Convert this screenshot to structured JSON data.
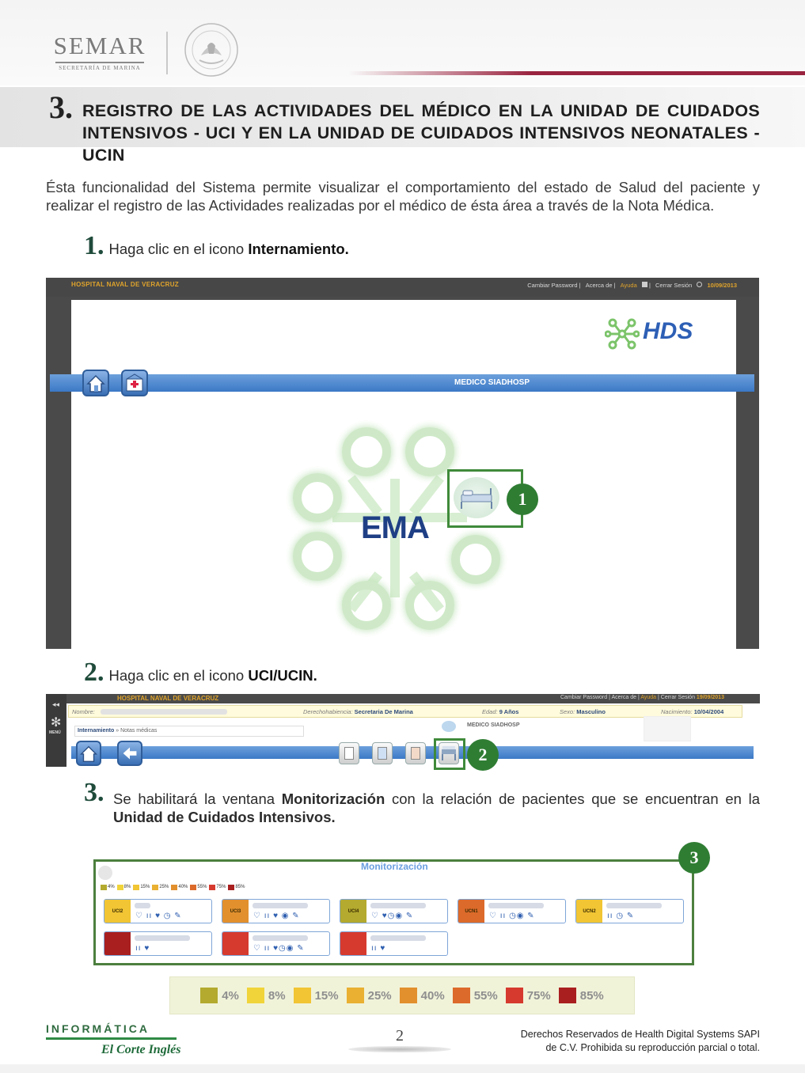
{
  "header": {
    "org_name": "SEMAR",
    "org_subtitle": "SECRETARÍA DE MARINA",
    "seal_text": "ESTADOS UNIDOS MEXICANOS"
  },
  "section": {
    "number": "3.",
    "title_line1": "REGISTRO DE LAS ACTIVIDADES DEL MÉDICO EN LA UNIDAD DE CUIDADOS",
    "title_line2": "INTENSIVOS - UCI Y EN LA UNIDAD DE CUIDADOS INTENSIVOS NEONATALES - UCIN"
  },
  "intro": "Ésta funcionalidad del Sistema permite visualizar el comportamiento del estado de Salud del paciente y realizar el registro de las Actividades realizadas por el médico de ésta área a través de la Nota Médica.",
  "steps": [
    {
      "num": "1.",
      "text": "Haga clic en el icono ",
      "bold": "Internamiento."
    },
    {
      "num": "2.",
      "text": "Haga clic en el icono ",
      "bold": "UCI/UCIN."
    },
    {
      "num": "3.",
      "text_a": "Se habilitará la ventana ",
      "bold_a": "Monitorización",
      "text_b": " con la relación de pacientes que se encuentran en la ",
      "bold_b": "Unidad de Cuidados Intensivos."
    }
  ],
  "screenshot1": {
    "hospital": "HOSPITAL NAVAL DE VERACRUZ",
    "links": [
      "Cambiar Password",
      "Acerca de",
      "Ayuda",
      "Cerrar Sesión"
    ],
    "date": "10/09/2013",
    "brand": "HDS",
    "banner": "MEDICO SIADHOSP",
    "center_logo": "EMA",
    "callout": "1",
    "icons": [
      "home-icon",
      "hospital-icon",
      "bed-icon"
    ]
  },
  "screenshot2": {
    "hospital": "HOSPITAL NAVAL DE VERACRUZ",
    "links": [
      "Cambiar Password",
      "Acerca de",
      "Ayuda",
      "Cerrar Sesión"
    ],
    "date": "19/09/2013",
    "patient": {
      "nombre_label": "Nombre:",
      "derecho_label": "Derechohabiencia:",
      "derecho_value": "Secretaria De Marina",
      "edad_label": "Edad:",
      "edad_value": "9 Años",
      "sexo_label": "Sexo:",
      "sexo_value": "Masculino",
      "nac_label": "Nacimiento:",
      "nac_value": "10/04/2004"
    },
    "breadcrumb_main": "Internamiento",
    "breadcrumb_sub": " » Notas médicas",
    "menu_label": "MENÚ",
    "banner": "MEDICO SIADHOSP",
    "callout": "2"
  },
  "monitor": {
    "title": "Monitorización",
    "callout": "3",
    "legend": [
      {
        "label": "4%",
        "color": "#b3aa2f"
      },
      {
        "label": "8%",
        "color": "#f0d43a"
      },
      {
        "label": "15%",
        "color": "#f1c534"
      },
      {
        "label": "25%",
        "color": "#e9b032"
      },
      {
        "label": "40%",
        "color": "#e2902e"
      },
      {
        "label": "55%",
        "color": "#dc6a2a"
      },
      {
        "label": "75%",
        "color": "#d63a2e"
      },
      {
        "label": "85%",
        "color": "#a91f1f"
      }
    ],
    "cards": [
      {
        "label": "UCI2",
        "color": "#f1c534",
        "icons": "♡ ıı ♥ ◷ ✎"
      },
      {
        "label": "UCI3",
        "color": "#e2902e",
        "icons": "♡ ıı ♥  ◉ ✎"
      },
      {
        "label": "UCI4",
        "color": "#b3aa2f",
        "icons": "♡  ♥◷◉ ✎"
      },
      {
        "label": "UCN1",
        "color": "#dc6a2a",
        "icons": "♡ ıı  ◷◉ ✎"
      },
      {
        "label": "UCN2",
        "color": "#f1c534",
        "icons": "  ıı  ◷  ✎"
      },
      {
        "label": "",
        "color": "#a91f1f",
        "icons": "  ıı ♥"
      },
      {
        "label": "",
        "color": "#d63a2e",
        "icons": "♡ ıı ♥◷◉ ✎"
      },
      {
        "label": "",
        "color": "#d63a2e",
        "icons": "  ıı ♥"
      }
    ]
  },
  "footer": {
    "brand": "INFORMÁTICA",
    "sub_brand": "El Corte Inglés",
    "page": "2",
    "rights_line1": "Derechos Reservados de Health Digital Systems SAPI",
    "rights_line2": "de C.V. Prohibida su reproducción parcial o total."
  }
}
